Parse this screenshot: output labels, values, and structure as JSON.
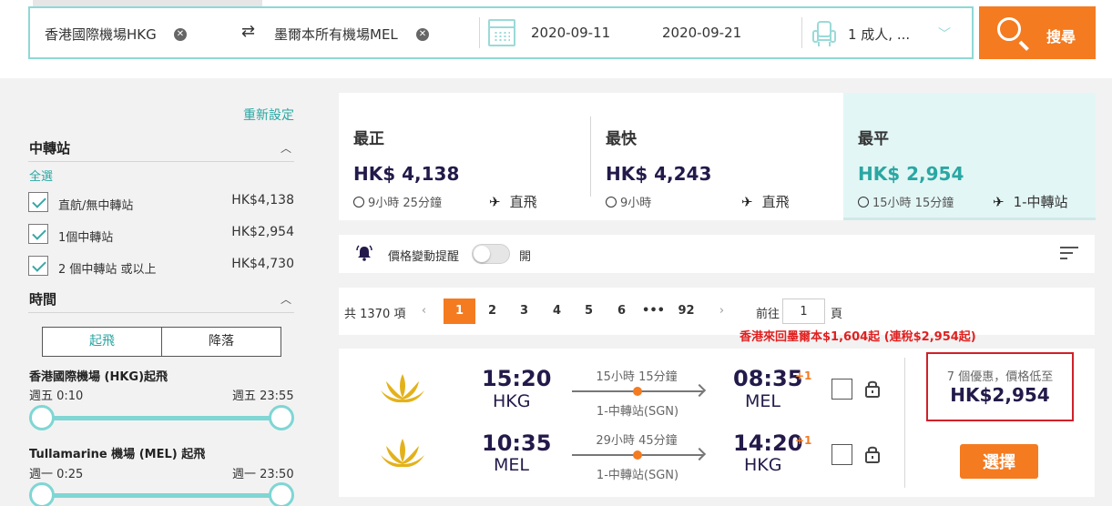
{
  "search": {
    "origin": "香港國際機場HKG",
    "destination": "墨爾本所有機場MEL",
    "depart_date": "2020-09-11",
    "return_date": "2020-09-21",
    "passengers": "1 成人, ...",
    "search_label": "搜尋"
  },
  "filters": {
    "reset_label": "重新設定",
    "stops_title": "中轉站",
    "select_all": "全選",
    "stop_options": [
      {
        "label": "直航/無中轉站",
        "price": "HK$4,138",
        "checked": true
      },
      {
        "label": "1個中轉站",
        "price": "HK$2,954",
        "checked": true
      },
      {
        "label": "2 個中轉站 或以上",
        "price": "HK$4,730",
        "checked": true
      }
    ],
    "time_title": "時間",
    "time_tabs": [
      "起飛",
      "降落"
    ],
    "airport_ranges": [
      {
        "title": "香港國際機場 (HKG)起飛",
        "from": "週五 0:10",
        "to": "週五 23:55"
      },
      {
        "title": "Tullamarine 機場 (MEL) 起飛",
        "from": "週一 0:25",
        "to": "週一 23:50"
      }
    ]
  },
  "summary": [
    {
      "title": "最正",
      "price": "HK$ 4,138",
      "duration": "9小時 25分鐘",
      "stops": "直飛",
      "active": false
    },
    {
      "title": "最快",
      "price": "HK$ 4,243",
      "duration": "9小時",
      "stops": "直飛",
      "active": false
    },
    {
      "title": "最平",
      "price": "HK$ 2,954",
      "duration": "15小時 15分鐘",
      "stops": "1-中轉站",
      "active": true
    }
  ],
  "alert": {
    "label": "價格變動提醒",
    "toggle_label": "開"
  },
  "pagination": {
    "total": "共 1370 項",
    "pages": [
      "1",
      "2",
      "3",
      "4",
      "5",
      "6",
      "•••",
      "92"
    ],
    "current": "1",
    "goto_label": "前往",
    "goto_value": "1",
    "page_label": "頁"
  },
  "promo": "香港來回墨爾本$1,604起 (連稅$2,954起)",
  "result": {
    "legs": [
      {
        "dep_time": "15:20",
        "dep_code": "HKG",
        "duration": "15小時 15分鐘",
        "stops": "1-中轉站(SGN)",
        "arr_time": "08:35",
        "arr_code": "MEL",
        "day_offset": "+1"
      },
      {
        "dep_time": "10:35",
        "dep_code": "MEL",
        "duration": "29小時 45分鐘",
        "stops": "1-中轉站(SGN)",
        "arr_time": "14:20",
        "arr_code": "HKG",
        "day_offset": "+1"
      }
    ],
    "deal_text": "7 個優惠，價格低至",
    "deal_price": "HK$2,954",
    "select_label": "選擇"
  },
  "colors": {
    "accent_orange": "#f47b20",
    "teal": "#2aa7a3",
    "navy": "#231a4a",
    "highlight_red": "#d0202a"
  }
}
